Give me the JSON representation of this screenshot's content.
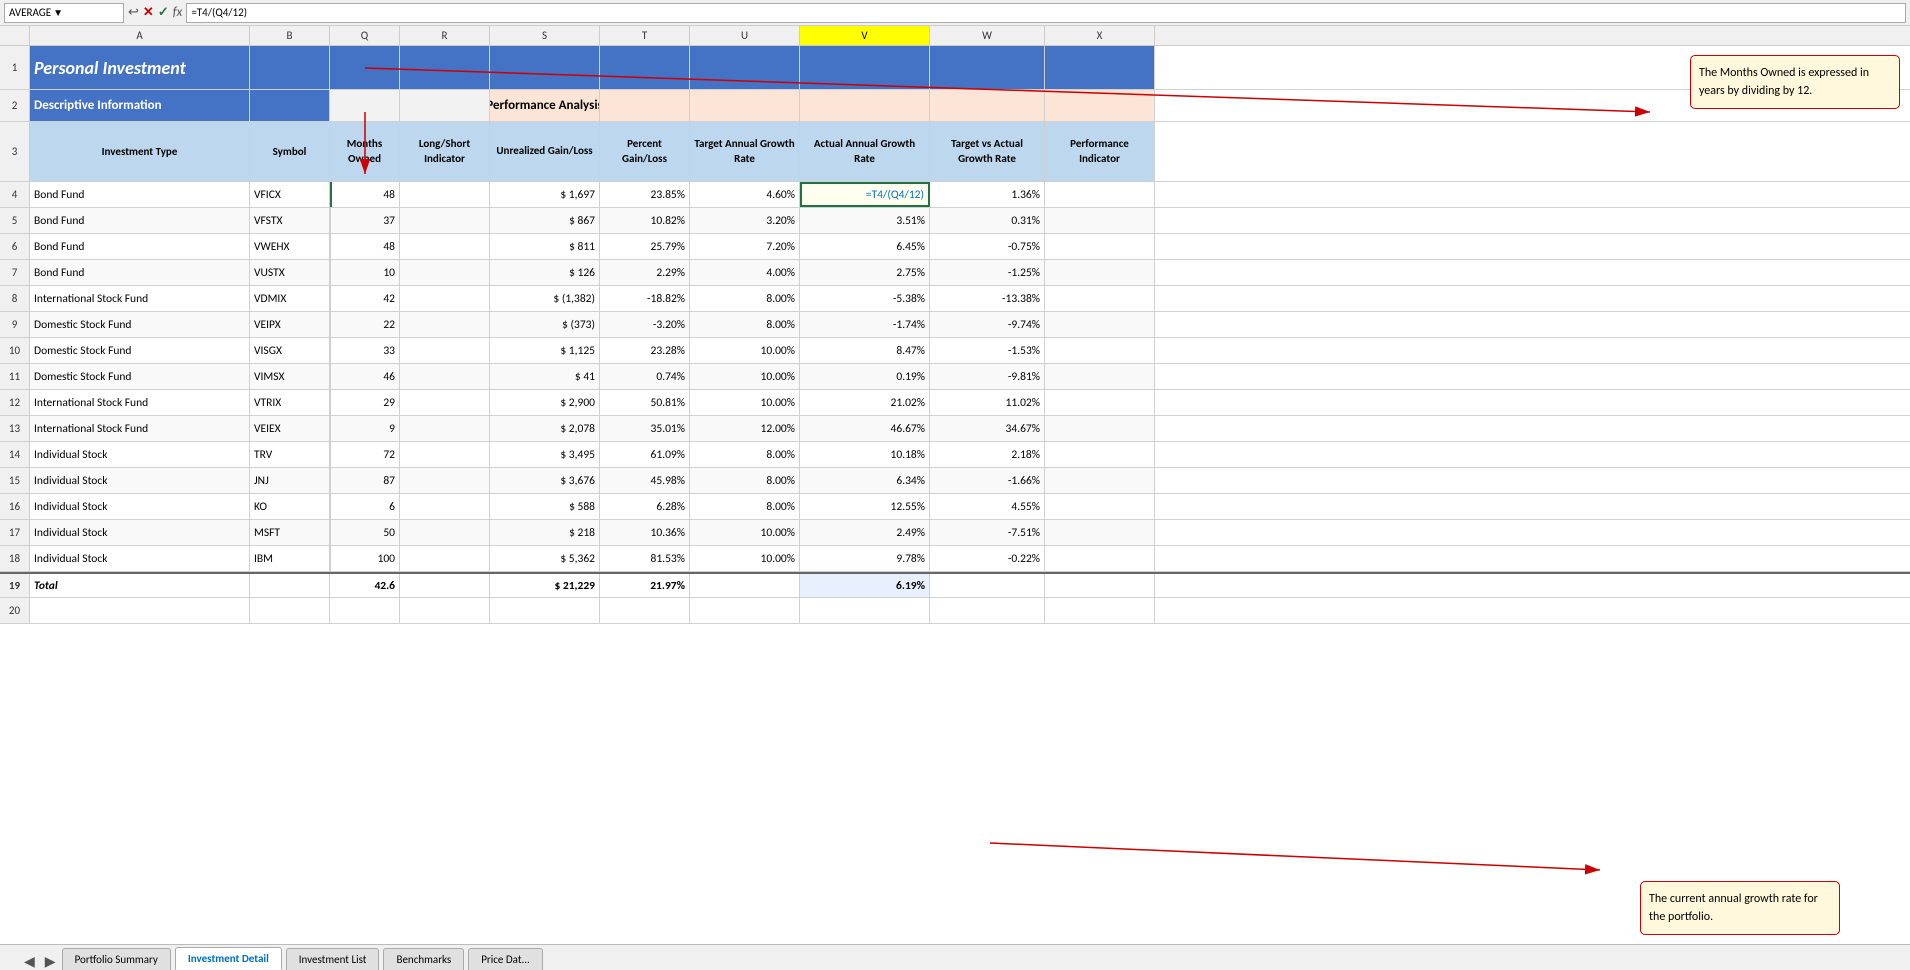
{
  "formula_bar": {
    "name_box": "AVERAGE",
    "formula": "=T4/(Q4/12)"
  },
  "column_headers": [
    "A",
    "B",
    "Q",
    "R",
    "S",
    "T",
    "U",
    "V",
    "W",
    "X"
  ],
  "row1": {
    "title": "Personal Investment"
  },
  "row2": {
    "desc_label": "Descriptive Information",
    "perf_label": "Performance Analysis"
  },
  "row3": {
    "col_a": "Investment Type",
    "col_b": "Symbol",
    "col_q": "Months Owned",
    "col_r": "Long/Short Indicator",
    "col_s": "Unrealized Gain/Loss",
    "col_t": "Percent Gain/Loss",
    "col_u": "Target Annual Growth Rate",
    "col_v": "Actual Annual Growth Rate",
    "col_w": "Target vs Actual Growth Rate",
    "col_x": "Performance Indicator"
  },
  "rows": [
    {
      "num": 4,
      "a": "Bond Fund",
      "b": "VFICX",
      "q": "48",
      "r": "",
      "s": "$ 1,697",
      "t": "23.85%",
      "u": "4.60%",
      "v": "=T4/(Q4/12)",
      "w": "1.36%",
      "x": "",
      "v_formula": true
    },
    {
      "num": 5,
      "a": "Bond Fund",
      "b": "VFSTX",
      "q": "37",
      "r": "",
      "s": "$ 867",
      "t": "10.82%",
      "u": "3.20%",
      "v": "3.51%",
      "w": "0.31%",
      "x": ""
    },
    {
      "num": 6,
      "a": "Bond Fund",
      "b": "VWEHX",
      "q": "48",
      "r": "",
      "s": "$ 811",
      "t": "25.79%",
      "u": "7.20%",
      "v": "6.45%",
      "w": "-0.75%",
      "x": ""
    },
    {
      "num": 7,
      "a": "Bond Fund",
      "b": "VUSTX",
      "q": "10",
      "r": "",
      "s": "$ 126",
      "t": "2.29%",
      "u": "4.00%",
      "v": "2.75%",
      "w": "-1.25%",
      "x": ""
    },
    {
      "num": 8,
      "a": "International Stock Fund",
      "b": "VDMIX",
      "q": "42",
      "r": "",
      "s": "$ (1,382)",
      "t": "-18.82%",
      "u": "8.00%",
      "v": "-5.38%",
      "w": "-13.38%",
      "x": ""
    },
    {
      "num": 9,
      "a": "Domestic Stock Fund",
      "b": "VEIPX",
      "q": "22",
      "r": "",
      "s": "$ (373)",
      "t": "-3.20%",
      "u": "8.00%",
      "v": "-1.74%",
      "w": "-9.74%",
      "x": ""
    },
    {
      "num": 10,
      "a": "Domestic Stock Fund",
      "b": "VISGX",
      "q": "33",
      "r": "",
      "s": "$ 1,125",
      "t": "23.28%",
      "u": "10.00%",
      "v": "8.47%",
      "w": "-1.53%",
      "x": ""
    },
    {
      "num": 11,
      "a": "Domestic Stock Fund",
      "b": "VIMSX",
      "q": "46",
      "r": "",
      "s": "$ 41",
      "t": "0.74%",
      "u": "10.00%",
      "v": "0.19%",
      "w": "-9.81%",
      "x": ""
    },
    {
      "num": 12,
      "a": "International Stock Fund",
      "b": "VTRIX",
      "q": "29",
      "r": "",
      "s": "$ 2,900",
      "t": "50.81%",
      "u": "10.00%",
      "v": "21.02%",
      "w": "11.02%",
      "x": ""
    },
    {
      "num": 13,
      "a": "International Stock Fund",
      "b": "VEIEX",
      "q": "9",
      "r": "",
      "s": "$ 2,078",
      "t": "35.01%",
      "u": "12.00%",
      "v": "46.67%",
      "w": "34.67%",
      "x": ""
    },
    {
      "num": 14,
      "a": "Individual Stock",
      "b": "TRV",
      "q": "72",
      "r": "",
      "s": "$ 3,495",
      "t": "61.09%",
      "u": "8.00%",
      "v": "10.18%",
      "w": "2.18%",
      "x": ""
    },
    {
      "num": 15,
      "a": "Individual Stock",
      "b": "JNJ",
      "q": "87",
      "r": "",
      "s": "$ 3,676",
      "t": "45.98%",
      "u": "8.00%",
      "v": "6.34%",
      "w": "-1.66%",
      "x": ""
    },
    {
      "num": 16,
      "a": "Individual Stock",
      "b": "KO",
      "q": "6",
      "r": "",
      "s": "$ 588",
      "t": "6.28%",
      "u": "8.00%",
      "v": "12.55%",
      "w": "4.55%",
      "x": ""
    },
    {
      "num": 17,
      "a": "Individual Stock",
      "b": "MSFT",
      "q": "50",
      "r": "",
      "s": "$ 218",
      "t": "10.36%",
      "u": "10.00%",
      "v": "2.49%",
      "w": "-7.51%",
      "x": ""
    },
    {
      "num": 18,
      "a": "Individual Stock",
      "b": "IBM",
      "q": "100",
      "r": "",
      "s": "$ 5,362",
      "t": "81.53%",
      "u": "10.00%",
      "v": "9.78%",
      "w": "-0.22%",
      "x": ""
    }
  ],
  "total_row": {
    "num": 19,
    "a": "Total",
    "q": "42.6",
    "s": "$ 21,229",
    "t": "21.97%",
    "v": "6.19%"
  },
  "callouts": {
    "top_right": "The Months Owned is expressed in years by dividing by 12.",
    "bottom_right": "The current annual growth rate for the portfolio."
  },
  "tabs": [
    "Portfolio Summary",
    "Investment Detail",
    "Investment List",
    "Benchmarks",
    "Price Dat..."
  ],
  "active_tab": "Investment Detail"
}
